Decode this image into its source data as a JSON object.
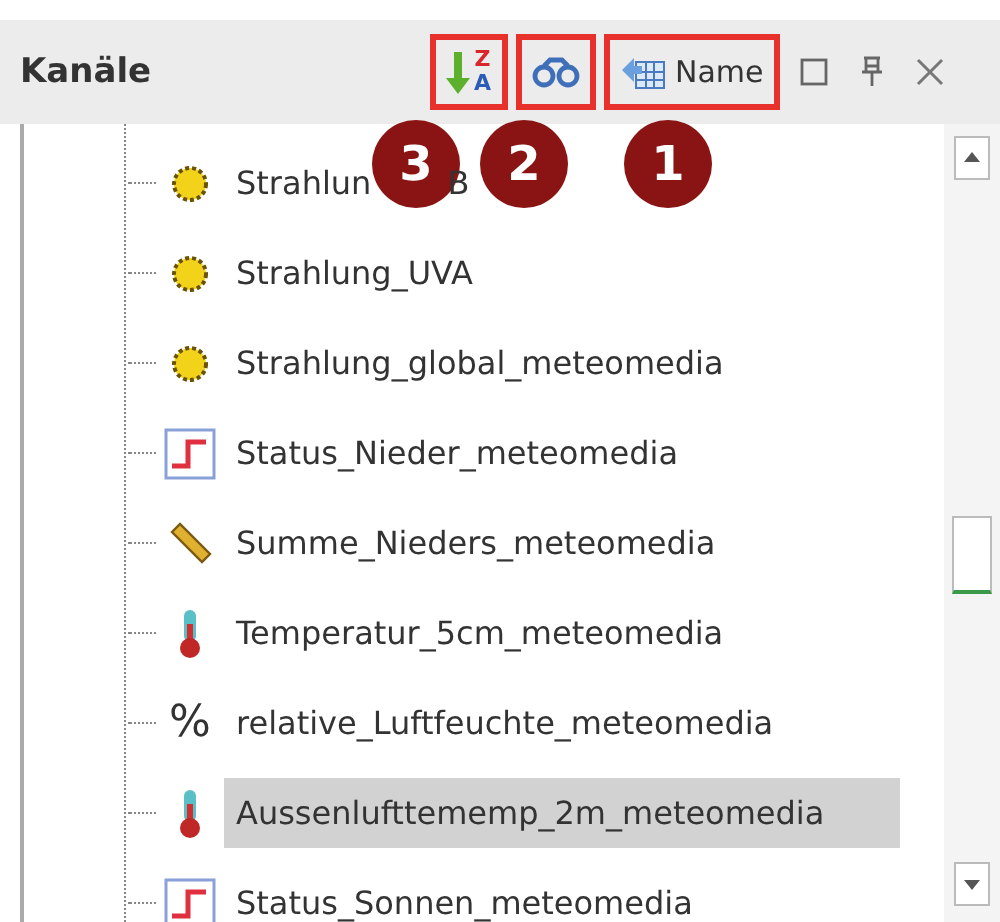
{
  "panel": {
    "title": "Kanäle"
  },
  "toolbar": [
    {
      "kind": "sort",
      "letters": [
        "Z",
        "A"
      ],
      "highlighted": true
    },
    {
      "kind": "find",
      "highlighted": true
    },
    {
      "kind": "name",
      "label": "Name",
      "highlighted": true
    }
  ],
  "window_controls": [
    {
      "kind": "maximize"
    },
    {
      "kind": "pin"
    },
    {
      "kind": "close"
    }
  ],
  "callouts": [
    {
      "number": "3"
    },
    {
      "number": "2"
    },
    {
      "number": "1"
    }
  ],
  "channels": [
    {
      "kind": "sun",
      "label": "Strahlun",
      "label_tail": "B",
      "selected": false
    },
    {
      "kind": "sun",
      "label": "Strahlung_UVA",
      "selected": false
    },
    {
      "kind": "sun",
      "label": "Strahlung_global_meteomedia",
      "selected": false
    },
    {
      "kind": "status",
      "label": "Status_Nieder_meteomedia",
      "selected": false
    },
    {
      "kind": "ruler",
      "label": "Summe_Nieders_meteomedia",
      "selected": false
    },
    {
      "kind": "thermometer",
      "label": "Temperatur_5cm_meteomedia",
      "selected": false
    },
    {
      "kind": "glyph",
      "glyph": "%",
      "label": "relative_Luftfeuchte_meteomedia",
      "selected": false
    },
    {
      "kind": "thermometer",
      "label": "Aussenlufttememp_2m_meteomedia",
      "selected": true
    },
    {
      "kind": "status",
      "label": "Status_Sonnen_meteomedia",
      "selected": false
    }
  ]
}
